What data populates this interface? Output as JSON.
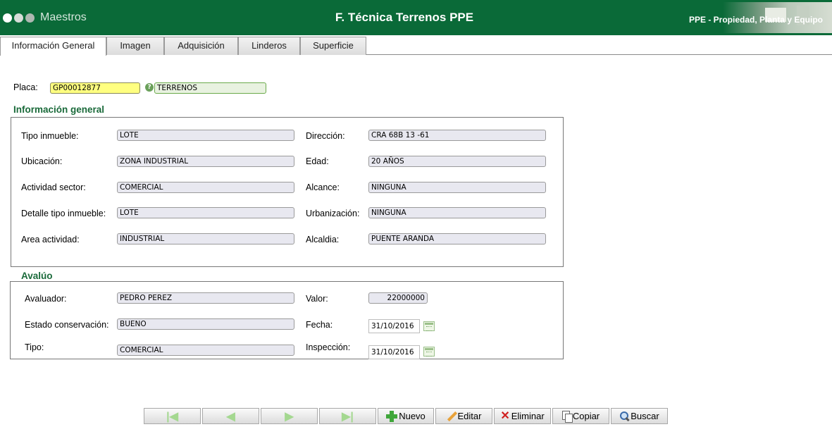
{
  "header": {
    "app_menu": "Maestros",
    "title": "F. Técnica Terrenos PPE",
    "subtitle": "PPE - Propiedad, Planta y Equipo"
  },
  "tabs": [
    {
      "label": "Información General",
      "active": true
    },
    {
      "label": "Imagen",
      "active": false
    },
    {
      "label": "Adquisición",
      "active": false
    },
    {
      "label": "Linderos",
      "active": false
    },
    {
      "label": "Superficie",
      "active": false
    }
  ],
  "placa": {
    "label": "Placa:",
    "value": "GP00012877",
    "help_icon": "question-icon",
    "description": "TERRENOS"
  },
  "info_general": {
    "title": "Información general",
    "left": [
      {
        "label": "Tipo inmueble:",
        "value": "LOTE"
      },
      {
        "label": "Ubicación:",
        "value": "ZONA INDUSTRIAL"
      },
      {
        "label": "Actividad sector:",
        "value": "COMERCIAL"
      },
      {
        "label": "Detalle tipo inmueble:",
        "value": "LOTE"
      },
      {
        "label": "Area actividad:",
        "value": "INDUSTRIAL"
      }
    ],
    "right": [
      {
        "label": "Dirección:",
        "value": "CRA 68B 13 -61"
      },
      {
        "label": "Edad:",
        "value": "20 AÑOS"
      },
      {
        "label": "Alcance:",
        "value": "NINGUNA"
      },
      {
        "label": "Urbanización:",
        "value": "NINGUNA"
      },
      {
        "label": "Alcaldia:",
        "value": "PUENTE ARANDA"
      }
    ]
  },
  "avaluo": {
    "title": "Avalúo",
    "evaluator": {
      "label": "Avaluador:",
      "value": "PEDRO PEREZ"
    },
    "valor": {
      "label": "Valor:",
      "value": "22000000"
    },
    "estado": {
      "label": "Estado conservación:",
      "value": "BUENO"
    },
    "fecha": {
      "label": "Fecha:",
      "value": "31/10/2016"
    },
    "tipo": {
      "label": "Tipo:",
      "value": "COMERCIAL"
    },
    "inspeccion": {
      "label": "Inspección:",
      "value": "31/10/2016"
    }
  },
  "toolbar": {
    "nuevo": "Nuevo",
    "editar": "Editar",
    "eliminar": "Eliminar",
    "copiar": "Copiar",
    "buscar": "Buscar"
  },
  "colors": {
    "header_bg": "#0a6a38",
    "section_title": "#1a6a3a",
    "placa_highlight": "#ffff80"
  }
}
